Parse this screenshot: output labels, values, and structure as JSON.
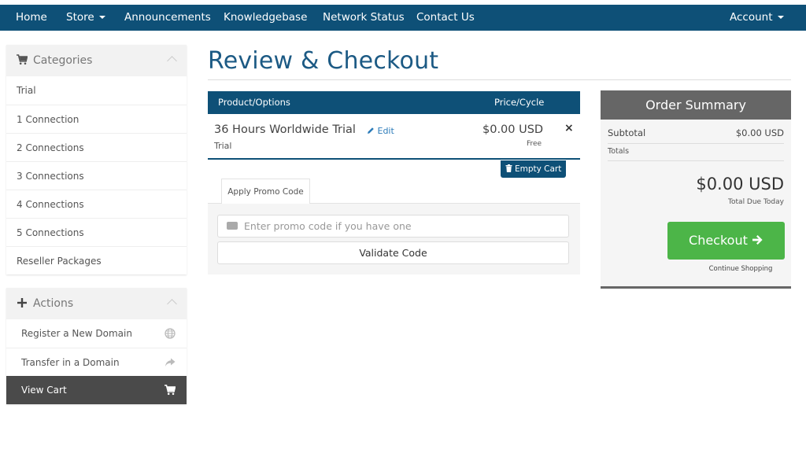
{
  "nav": {
    "home": "Home",
    "store": "Store",
    "announcements": "Announcements",
    "knowledgebase": "Knowledgebase",
    "network_status": "Network Status",
    "contact_us": "Contact Us",
    "account": "Account"
  },
  "sidebar": {
    "categories_title": "Categories",
    "categories": [
      {
        "label": "Trial"
      },
      {
        "label": "1 Connection"
      },
      {
        "label": "2 Connections"
      },
      {
        "label": "3 Connections"
      },
      {
        "label": "4 Connections"
      },
      {
        "label": "5 Connections"
      },
      {
        "label": "Reseller Packages"
      }
    ],
    "actions_title": "Actions",
    "actions": [
      {
        "label": "Register a New Domain",
        "icon": "globe-icon"
      },
      {
        "label": "Transfer in a Domain",
        "icon": "share-arrow-icon"
      },
      {
        "label": "View Cart",
        "icon": "cart-icon"
      }
    ]
  },
  "main": {
    "title": "Review & Checkout",
    "columns": {
      "product": "Product/Options",
      "price": "Price/Cycle"
    },
    "item": {
      "name": "36 Hours Worldwide Trial",
      "edit": "Edit",
      "group": "Trial",
      "price": "$0.00 USD",
      "cycle": "Free",
      "remove": "×"
    },
    "empty_cart": "Empty Cart",
    "promo": {
      "tab": "Apply Promo Code",
      "placeholder": "Enter promo code if you have one",
      "validate": "Validate Code"
    }
  },
  "summary": {
    "title": "Order Summary",
    "subtotal_label": "Subtotal",
    "subtotal_value": "$0.00 USD",
    "totals_label": "Totals",
    "total_amount": "$0.00 USD",
    "total_due_label": "Total Due Today",
    "checkout": "Checkout",
    "continue": "Continue Shopping"
  },
  "colors": {
    "nav_bg": "#0e5077",
    "title": "#1c5a84",
    "checkout_green": "#4cb548",
    "summary_head": "#666666"
  }
}
